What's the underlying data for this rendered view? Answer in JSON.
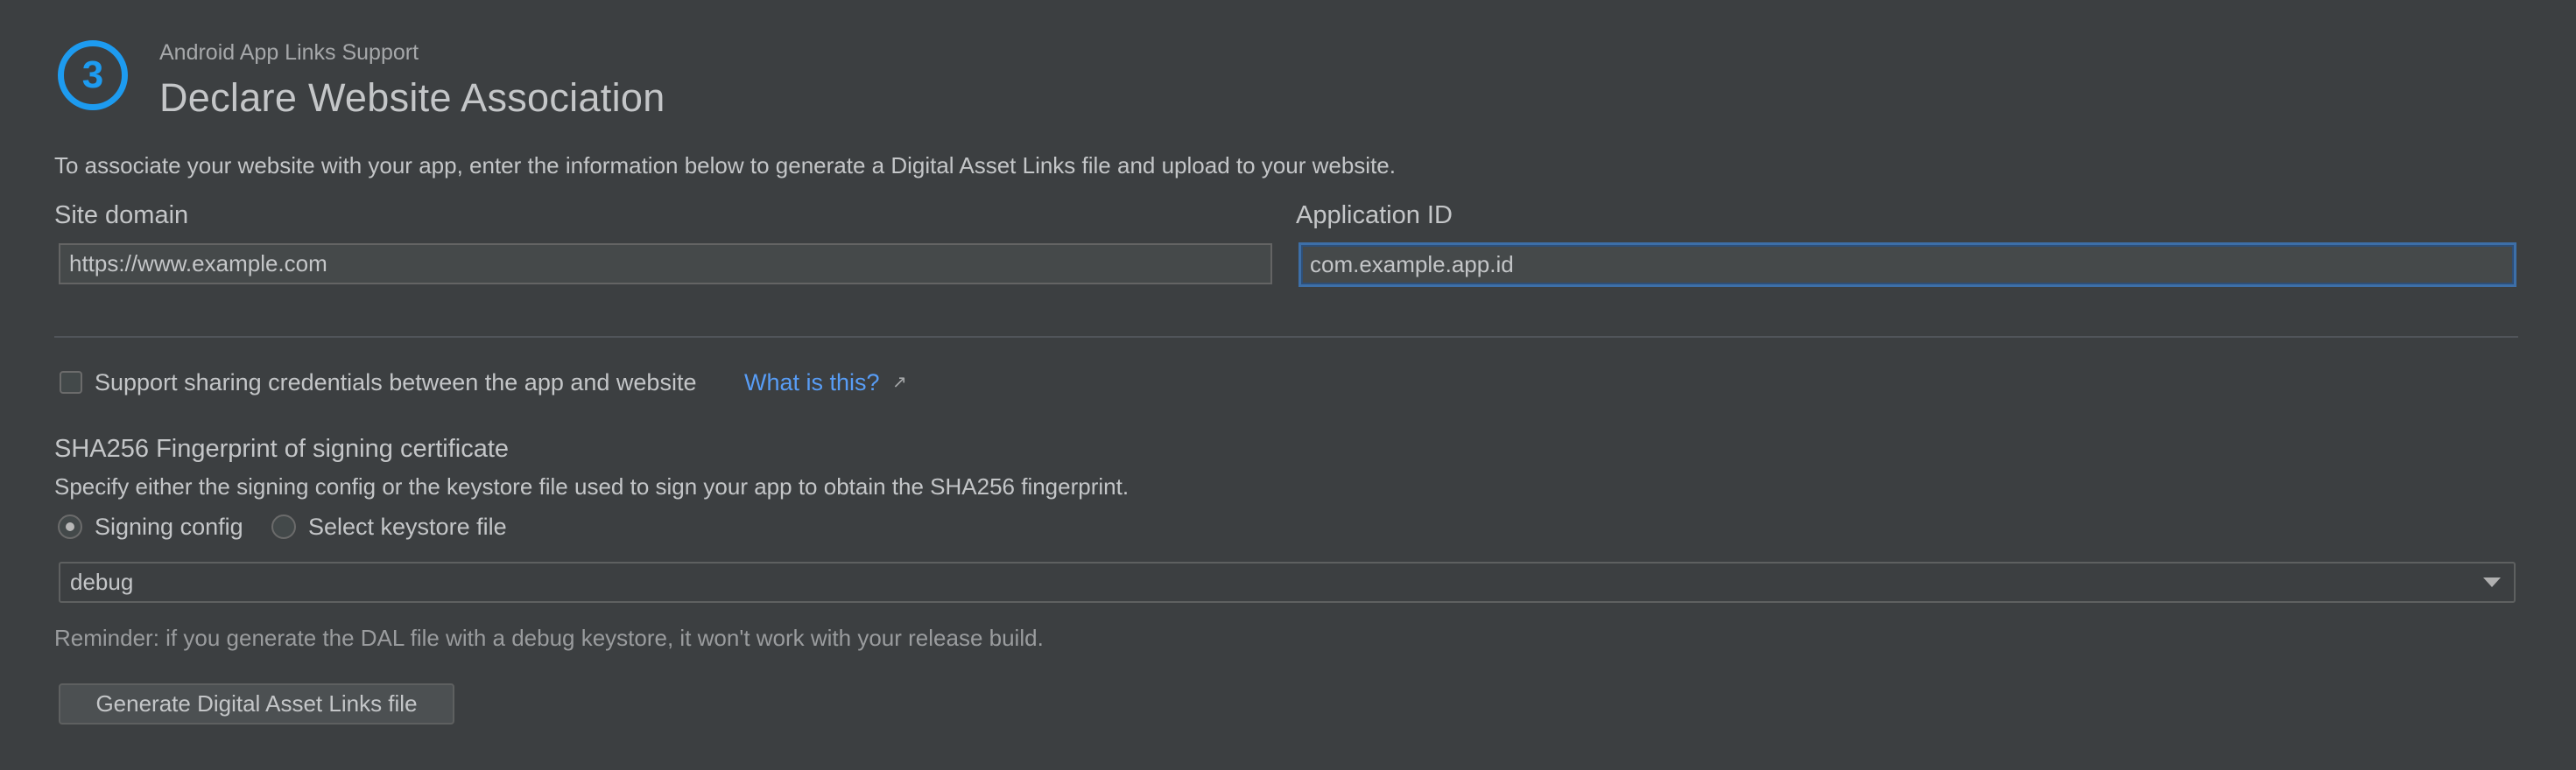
{
  "step": {
    "number": "3",
    "supertitle": "Android App Links Support",
    "title": "Declare Website Association"
  },
  "intro": "To associate your website with your app, enter the information below to generate a Digital Asset Links file and upload to your website.",
  "site_domain": {
    "label": "Site domain",
    "value": "https://www.example.com"
  },
  "application_id": {
    "label": "Application ID",
    "value": "com.example.app.id"
  },
  "credentials": {
    "checked": false,
    "label": "Support sharing credentials between the app and website",
    "link_text": "What is this?",
    "link_icon": "external-link-icon",
    "link_glyph": "↗"
  },
  "fingerprint": {
    "title": "SHA256 Fingerprint of signing certificate",
    "description": "Specify either the signing config or the keystore file used to sign your app to obtain the SHA256 fingerprint.",
    "options": [
      {
        "label": "Signing config",
        "selected": true
      },
      {
        "label": "Select keystore file",
        "selected": false
      }
    ],
    "signing_config_value": "debug",
    "reminder": "Reminder: if you generate the DAL file with a debug keystore, it won't work with your release build."
  },
  "generate_button": "Generate Digital Asset Links file",
  "colors": {
    "background": "#3c3f41",
    "accent": "#1d9bf0",
    "link": "#589df6",
    "focus_border": "#3d6fa8"
  }
}
